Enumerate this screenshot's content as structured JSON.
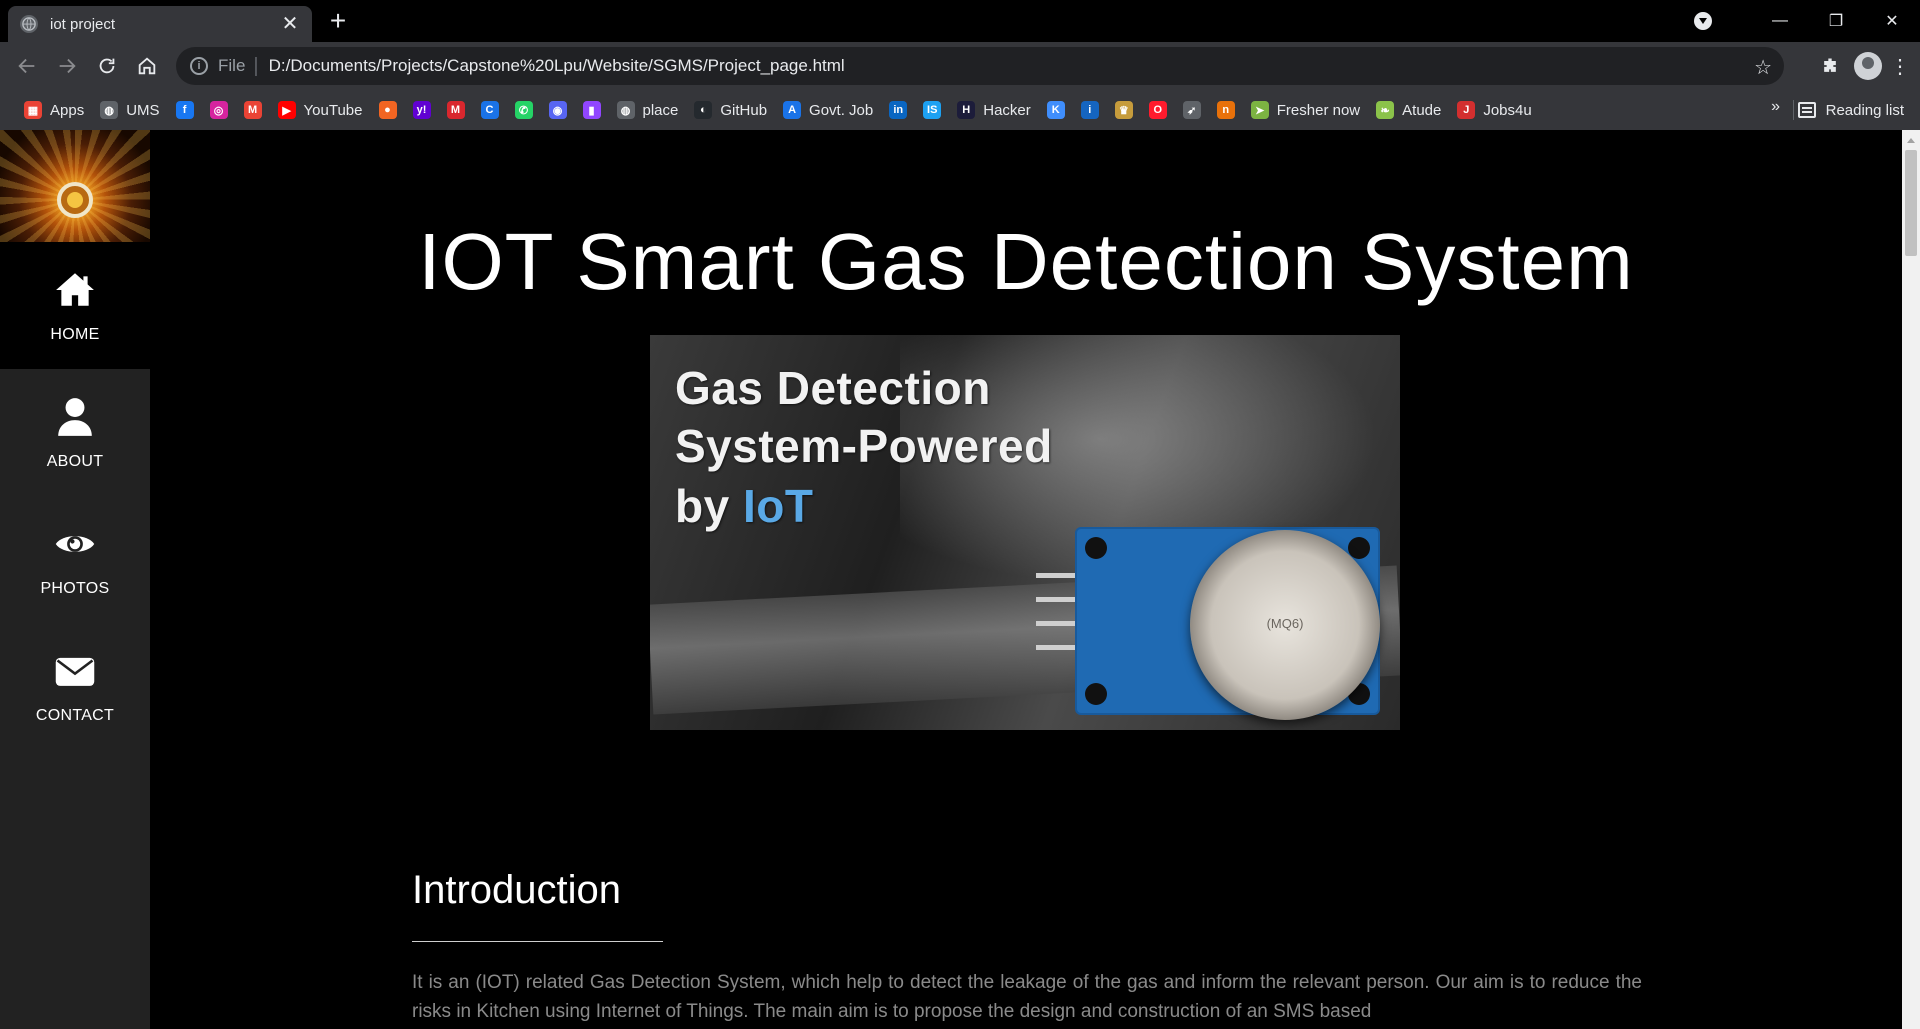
{
  "browser": {
    "tab_title": "iot project",
    "tab_close": "✕",
    "new_tab": "+",
    "url_scheme": "File",
    "url": "D:/Documents/Projects/Capstone%20Lpu/Website/SGMS/Project_page.html",
    "window_controls": {
      "minimize": "—",
      "restore": "❐",
      "close": "✕"
    }
  },
  "bookmarks": [
    {
      "label": "Apps",
      "icon": "apps-grid-icon",
      "color": "#ea4335"
    },
    {
      "label": "UMS",
      "icon": "globe-icon",
      "color": "#5f6368"
    },
    {
      "label": "",
      "icon": "facebook-icon",
      "color": "#1877f2"
    },
    {
      "label": "",
      "icon": "instagram-icon",
      "color": "#d6249f"
    },
    {
      "label": "",
      "icon": "gmail-icon",
      "color": "#ea4335"
    },
    {
      "label": "YouTube",
      "icon": "youtube-icon",
      "color": "#ff0000"
    },
    {
      "label": "",
      "icon": "basketball-icon",
      "color": "#f26522"
    },
    {
      "label": "",
      "icon": "yahoo-icon",
      "color": "#6001d2"
    },
    {
      "label": "",
      "icon": "mega-icon",
      "color": "#d9272e"
    },
    {
      "label": "",
      "icon": "c-icon",
      "color": "#1a73e8"
    },
    {
      "label": "",
      "icon": "whatsapp-icon",
      "color": "#25d366"
    },
    {
      "label": "",
      "icon": "discord-icon",
      "color": "#5865f2"
    },
    {
      "label": "",
      "icon": "twitch-icon",
      "color": "#9146ff"
    },
    {
      "label": "place",
      "icon": "globe-icon",
      "color": "#5f6368"
    },
    {
      "label": "GitHub",
      "icon": "github-icon",
      "color": "#24292e"
    },
    {
      "label": "Govt. Job",
      "icon": "govt-job-icon",
      "color": "#1a73e8"
    },
    {
      "label": "",
      "icon": "linkedin-icon",
      "color": "#0a66c2"
    },
    {
      "label": "",
      "icon": "is-icon",
      "color": "#1da1f2"
    },
    {
      "label": "Hacker",
      "icon": "hacker-icon",
      "color": "#1c1c3a"
    },
    {
      "label": "",
      "icon": "k-icon",
      "color": "#3f8efc"
    },
    {
      "label": "",
      "icon": "info-icon",
      "color": "#1565c0"
    },
    {
      "label": "",
      "icon": "emblem-icon",
      "color": "#c69c3c"
    },
    {
      "label": "",
      "icon": "opera-icon",
      "color": "#ff1b2d"
    },
    {
      "label": "",
      "icon": "runner-icon",
      "color": "#5f6368"
    },
    {
      "label": "",
      "icon": "n-icon",
      "color": "#e8710a"
    },
    {
      "label": "Fresher now",
      "icon": "fresher-icon",
      "color": "#7cb342"
    },
    {
      "label": "Atude",
      "icon": "atude-icon",
      "color": "#8bc34a"
    },
    {
      "label": "Jobs4u",
      "icon": "jobs4u-icon",
      "color": "#d32f2f"
    }
  ],
  "bookmarks_more": "»",
  "reading_list": "Reading list",
  "sidebar": {
    "items": [
      {
        "label": "HOME",
        "icon": "home-icon",
        "active": true
      },
      {
        "label": "ABOUT",
        "icon": "user-icon",
        "active": false
      },
      {
        "label": "PHOTOS",
        "icon": "eye-icon",
        "active": false
      },
      {
        "label": "CONTACT",
        "icon": "envelope-icon",
        "active": false
      }
    ]
  },
  "page": {
    "title": "IOT Smart Gas Detection System",
    "hero": {
      "line1": "Gas Detection",
      "line2": "System-Powered",
      "line3_prefix": "by ",
      "line3_accent": "IoT",
      "sensor_label": "(MQ6)"
    },
    "intro_heading": "Introduction",
    "intro_text": "It is an (IOT) related Gas Detection System, which help to detect the leakage of the gas and inform the relevant person. Our aim is to reduce the risks in Kitchen using Internet of Things. The main aim is to propose the design and construction of an SMS based"
  },
  "colors": {
    "page_bg": "#000000",
    "sidebar_bg": "#222222",
    "accent_iot": "#5aa9e6",
    "body_text": "#8a8a8a"
  }
}
